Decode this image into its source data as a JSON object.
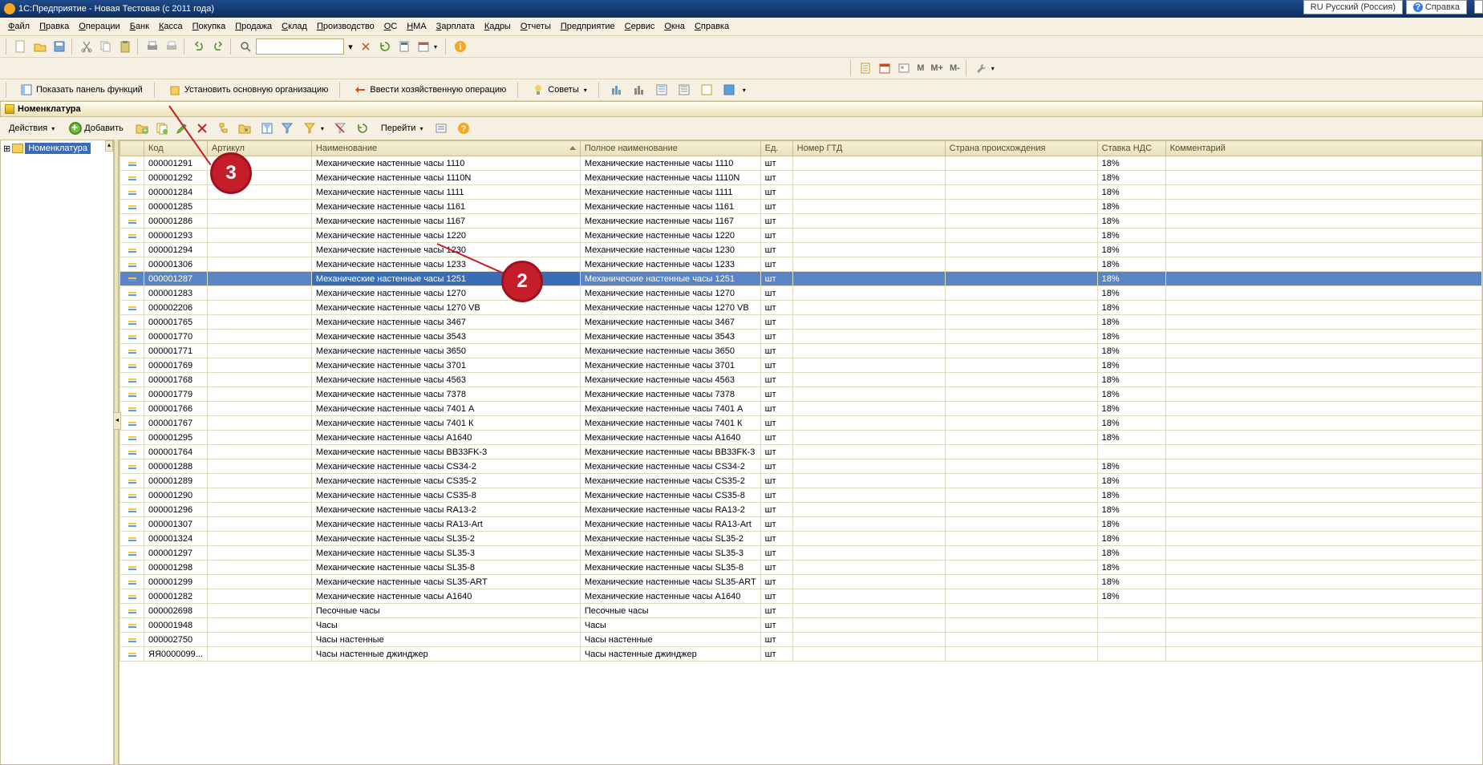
{
  "title": "1С:Предприятие - Новая Тестовая (с 2011 года)",
  "lang_switch": "RU Русский (Россия)",
  "help_label": "Справка",
  "main_menu": [
    "Файл",
    "Правка",
    "Операции",
    "Банк",
    "Касса",
    "Покупка",
    "Продажа",
    "Склад",
    "Производство",
    "ОС",
    "НМА",
    "Зарплата",
    "Кадры",
    "Отчеты",
    "Предприятие",
    "Сервис",
    "Окна",
    "Справка"
  ],
  "toolbar2_items": [
    "М",
    "М+",
    "М-"
  ],
  "toolbar3": {
    "show_panel": "Показать панель функций",
    "set_org": "Установить основную организацию",
    "enter_op": "Ввести хозяйственную операцию",
    "advice": "Советы"
  },
  "list_title": "Номенклатура",
  "list_toolbar": {
    "actions": "Действия",
    "add": "Добавить",
    "goto": "Перейти"
  },
  "tree_root": "Номенклатура",
  "columns": [
    "",
    "Код",
    "Артикул",
    "Наименование",
    "Полное наименование",
    "Ед.",
    "Номер ГТД",
    "Страна происхождения",
    "Ставка НДС",
    "Комментарий"
  ],
  "selected_row_index": 8,
  "callouts": {
    "c2": "2",
    "c3": "3"
  },
  "rows": [
    {
      "code": "000001291",
      "name": "Механические настенные часы 1110",
      "full": "Механические настенные часы 1110",
      "unit": "шт",
      "vat": "18%"
    },
    {
      "code": "000001292",
      "name": "Механические настенные часы 1110N",
      "full": "Механические настенные часы 1110N",
      "unit": "шт",
      "vat": "18%"
    },
    {
      "code": "000001284",
      "name": "Механические настенные часы 1111",
      "full": "Механические настенные часы 1111",
      "unit": "шт",
      "vat": "18%"
    },
    {
      "code": "000001285",
      "name": "Механические настенные часы 1161",
      "full": "Механические настенные часы 1161",
      "unit": "шт",
      "vat": "18%"
    },
    {
      "code": "000001286",
      "name": "Механические настенные часы 1167",
      "full": "Механические настенные часы 1167",
      "unit": "шт",
      "vat": "18%"
    },
    {
      "code": "000001293",
      "name": "Механические настенные часы 1220",
      "full": "Механические настенные часы 1220",
      "unit": "шт",
      "vat": "18%"
    },
    {
      "code": "000001294",
      "name": "Механические настенные часы 1230",
      "full": "Механические настенные часы 1230",
      "unit": "шт",
      "vat": "18%"
    },
    {
      "code": "000001306",
      "name": "Механические настенные часы 1233",
      "full": "Механические настенные часы 1233",
      "unit": "шт",
      "vat": "18%"
    },
    {
      "code": "000001287",
      "name": "Механические настенные часы 1251",
      "full": "Механические настенные часы 1251",
      "unit": "шт",
      "vat": "18%"
    },
    {
      "code": "000001283",
      "name": "Механические настенные часы 1270",
      "full": "Механические настенные часы 1270",
      "unit": "шт",
      "vat": "18%"
    },
    {
      "code": "000002206",
      "name": "Механические настенные часы 1270 VB",
      "full": "Механические настенные часы 1270 VB",
      "unit": "шт",
      "vat": "18%"
    },
    {
      "code": "000001765",
      "name": "Механические настенные часы 3467",
      "full": "Механические настенные часы 3467",
      "unit": "шт",
      "vat": "18%"
    },
    {
      "code": "000001770",
      "name": "Механические настенные часы 3543",
      "full": "Механические настенные часы 3543",
      "unit": "шт",
      "vat": "18%"
    },
    {
      "code": "000001771",
      "name": "Механические настенные часы 3650",
      "full": "Механические настенные часы 3650",
      "unit": "шт",
      "vat": "18%"
    },
    {
      "code": "000001769",
      "name": "Механические настенные часы 3701",
      "full": "Механические настенные часы 3701",
      "unit": "шт",
      "vat": "18%"
    },
    {
      "code": "000001768",
      "name": "Механические настенные часы 4563",
      "full": "Механические настенные часы 4563",
      "unit": "шт",
      "vat": "18%"
    },
    {
      "code": "000001779",
      "name": "Механические настенные часы 7378",
      "full": "Механические настенные часы 7378",
      "unit": "шт",
      "vat": "18%"
    },
    {
      "code": "000001766",
      "name": "Механические настенные часы 7401 А",
      "full": "Механические настенные часы 7401 А",
      "unit": "шт",
      "vat": "18%"
    },
    {
      "code": "000001767",
      "name": "Механические настенные часы 7401 К",
      "full": "Механические настенные часы 7401 К",
      "unit": "шт",
      "vat": "18%"
    },
    {
      "code": "000001295",
      "name": "Механические настенные часы А1640",
      "full": "Механические настенные часы А1640",
      "unit": "шт",
      "vat": "18%"
    },
    {
      "code": "000001764",
      "name": "Механические настенные часы ВВ33FK-3",
      "full": "Механические настенные часы ВВ33FК-3",
      "unit": "шт",
      "vat": ""
    },
    {
      "code": "000001288",
      "name": "Механические настенные часы CS34-2",
      "full": "Механические настенные часы CS34-2",
      "unit": "шт",
      "vat": "18%"
    },
    {
      "code": "000001289",
      "name": "Механические настенные часы CS35-2",
      "full": "Механические настенные часы CS35-2",
      "unit": "шт",
      "vat": "18%"
    },
    {
      "code": "000001290",
      "name": "Механические настенные часы CS35-8",
      "full": "Механические настенные часы CS35-8",
      "unit": "шт",
      "vat": "18%"
    },
    {
      "code": "000001296",
      "name": "Механические настенные часы RA13-2",
      "full": "Механические настенные часы RA13-2",
      "unit": "шт",
      "vat": "18%"
    },
    {
      "code": "000001307",
      "name": "Механические настенные часы RA13-Art",
      "full": "Механические настенные часы RA13-Art",
      "unit": "шт",
      "vat": "18%"
    },
    {
      "code": "000001324",
      "name": "Механические настенные часы SL35-2",
      "full": "Механические настенные часы SL35-2",
      "unit": "шт",
      "vat": "18%"
    },
    {
      "code": "000001297",
      "name": "Механические настенные часы SL35-3",
      "full": "Механические настенные часы SL35-3",
      "unit": "шт",
      "vat": "18%"
    },
    {
      "code": "000001298",
      "name": "Механические настенные часы SL35-8",
      "full": "Механические настенные часы SL35-8",
      "unit": "шт",
      "vat": "18%"
    },
    {
      "code": "000001299",
      "name": "Механические настенные часы SL35-ART",
      "full": "Механические настенные часы SL35-ART",
      "unit": "шт",
      "vat": "18%"
    },
    {
      "code": "000001282",
      "name": "Механические настенные часы А1640",
      "full": "Механические настенные часы А1640",
      "unit": "шт",
      "vat": "18%"
    },
    {
      "code": "000002698",
      "name": "Песочные часы",
      "full": "Песочные часы",
      "unit": "шт",
      "vat": ""
    },
    {
      "code": "000001948",
      "name": "Часы",
      "full": "Часы",
      "unit": "шт",
      "vat": ""
    },
    {
      "code": "000002750",
      "name": "Часы настенные",
      "full": "Часы настенные",
      "unit": "шт",
      "vat": ""
    },
    {
      "code": "ЯЯ0000099...",
      "name": "Часы настенные джинджер",
      "full": "Часы настенные джинджер",
      "unit": "шт",
      "vat": ""
    }
  ]
}
